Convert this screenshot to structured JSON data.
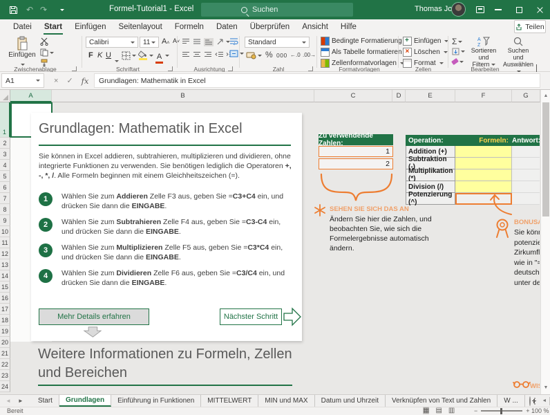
{
  "titlebar": {
    "title": "Formel-Tutorial1 - Excel",
    "search_placeholder": "Suchen",
    "user": "Thomas Joos"
  },
  "icons": {
    "undo": "↶",
    "redo": "↷",
    "font_letter": "A",
    "autosum": "Σ",
    "percent": "%",
    "thousands": "000",
    "inc_decimal": "←.0",
    "dec_decimal": ".00→",
    "up_arrow": "▲",
    "down_arrow": "▼",
    "left_arrow": "◄",
    "right_arrow": "►",
    "view_normal": "▦",
    "view_layout": "▤",
    "view_break": "▥",
    "minus": "−",
    "plus": "+",
    "cancel": "×",
    "enter": "✓"
  },
  "menu": {
    "items": [
      "Datei",
      "Start",
      "Einfügen",
      "Seitenlayout",
      "Formeln",
      "Daten",
      "Überprüfen",
      "Ansicht",
      "Hilfe"
    ],
    "active": "Start",
    "share": "Teilen"
  },
  "ribbon": {
    "clipboard": {
      "paste": "Einfügen",
      "label": "Zwischenablage"
    },
    "font": {
      "name": "Calibri",
      "size": "11",
      "bold": "F",
      "italic": "K",
      "underline": "U",
      "label": "Schriftart"
    },
    "alignment": {
      "label": "Ausrichtung"
    },
    "number": {
      "format": "Standard",
      "label": "Zahl"
    },
    "styles": {
      "items": [
        "Bedingte Formatierung",
        "Als Tabelle formatieren",
        "Zellenformatvorlagen"
      ],
      "label": "Formatvorlagen"
    },
    "cells": {
      "items": [
        "Einfügen",
        "Löschen",
        "Format"
      ],
      "label": "Zellen"
    },
    "editing": {
      "sort1": "Sortieren und",
      "sort2": "Filtern",
      "find1": "Suchen und",
      "find2": "Auswählen",
      "label": "Bearbeiten"
    }
  },
  "formula_bar": {
    "name_box": "A1",
    "fx": "fx",
    "value": "Grundlagen: Mathematik in Excel"
  },
  "grid": {
    "columns": [
      "A",
      "B",
      "C",
      "D",
      "E",
      "F",
      "G"
    ],
    "rows": [
      "1",
      "2",
      "3",
      "4",
      "5",
      "6",
      "7",
      "8",
      "9",
      "10",
      "11",
      "12",
      "13",
      "14",
      "15",
      "16",
      "17",
      "18",
      "19",
      "20",
      "21",
      "22",
      "23",
      "24"
    ]
  },
  "doc": {
    "title": "Grundlagen: Mathematik in Excel",
    "intro": [
      {
        "t": "Sie können in Excel addieren, subtrahieren, multiplizieren und dividieren, ohne integrierte Funktionen zu verwenden. Sie benötigen lediglich die Operatoren "
      },
      {
        "t": "+, -, *, /",
        "b": true
      },
      {
        "t": ". Alle Formeln beginnen mit einem Gleichheitszeichen (=)."
      }
    ],
    "steps": [
      {
        "num": "1",
        "segments": [
          {
            "t": "Wählen Sie zum "
          },
          {
            "t": "Addieren",
            "b": true
          },
          {
            "t": " Zelle F3 aus, geben Sie ="
          },
          {
            "t": "C3+C4",
            "b": true
          },
          {
            "t": " ein, und drücken Sie dann die "
          },
          {
            "t": "EINGABE",
            "b": true
          },
          {
            "t": "."
          }
        ]
      },
      {
        "num": "2",
        "segments": [
          {
            "t": "Wählen Sie zum "
          },
          {
            "t": "Subtrahieren",
            "b": true
          },
          {
            "t": " Zelle F4 aus, geben Sie ="
          },
          {
            "t": "C3-C4",
            "b": true
          },
          {
            "t": " ein, und drücken Sie dann die "
          },
          {
            "t": "EINGABE",
            "b": true
          },
          {
            "t": "."
          }
        ]
      },
      {
        "num": "3",
        "segments": [
          {
            "t": "Wählen Sie zum "
          },
          {
            "t": "Multiplizieren",
            "b": true
          },
          {
            "t": " Zelle F5 aus, geben Sie ="
          },
          {
            "t": "C3*C4",
            "b": true
          },
          {
            "t": " ein, und drücken Sie dann die "
          },
          {
            "t": "EINGABE",
            "b": true
          },
          {
            "t": "."
          }
        ]
      },
      {
        "num": "4",
        "segments": [
          {
            "t": "Wählen Sie zum "
          },
          {
            "t": "Dividieren",
            "b": true
          },
          {
            "t": " Zelle F6 aus, geben Sie ="
          },
          {
            "t": "C3/C4",
            "b": true
          },
          {
            "t": " ein, und drücken Sie dann die "
          },
          {
            "t": "EINGABE",
            "b": true
          },
          {
            "t": "."
          }
        ]
      }
    ],
    "more_button": "Mehr Details erfahren",
    "next_button": "Nächster Schritt",
    "section_title": "Weitere Informationen zu Formeln, Zellen und Bereichen"
  },
  "panel": {
    "numbers_header": "Zu verwendende Zahlen:",
    "numbers": [
      "1",
      "2"
    ],
    "watch_title": "SEHEN SIE SICH DAS AN",
    "watch_text": "Ändern Sie hier die Zahlen, und beobachten Sie, wie sich die Formelergebnisse automatisch ändern.",
    "table": {
      "headers": [
        "Operation:",
        "Formeln:",
        "Antwort:"
      ],
      "rows": [
        "Addition (+)",
        "Subtraktion (-)",
        "Multiplikation (*)",
        "Division (/)",
        "Potenzierung (^)"
      ]
    },
    "bonus_title": "BONUSA",
    "bonus_lines": [
      "Sie könn",
      "potenzie",
      "Zirkumfl",
      "wie in \"=",
      "deutsch-",
      "unter de"
    ],
    "wissen_label": "WISSEN"
  },
  "sheets": {
    "items": [
      "Start",
      "Grundlagen",
      "Einführung in Funktionen",
      "MITTELWERT",
      "MIN und MAX",
      "Datum und Uhrzeit",
      "Verknüpfen von Text und Zahlen",
      "W ..."
    ],
    "active": "Grundlagen"
  },
  "status": {
    "ready": "Bereit",
    "zoom": "100 %"
  },
  "colors": {
    "accent": "#217346",
    "orange": "#ED7D31",
    "formula_cell": "#FFFF9E",
    "header_yellow": "#FFD34D"
  }
}
